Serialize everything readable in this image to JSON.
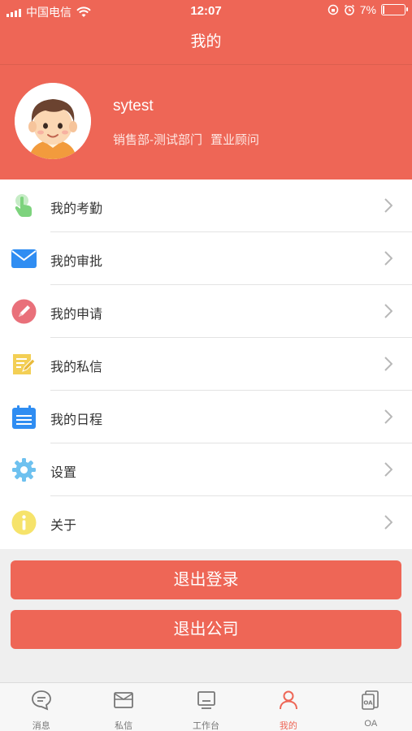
{
  "status_bar": {
    "carrier": "中国电信",
    "time": "12:07",
    "battery": "7%",
    "battery_level": 0.07
  },
  "nav": {
    "title": "我的"
  },
  "profile": {
    "username": "sytest",
    "department": "销售部-测试部门",
    "role": "置业顾问"
  },
  "menu": [
    {
      "label": "我的考勤",
      "icon": "attendance-hand-icon",
      "color": "#7dd37d"
    },
    {
      "label": "我的审批",
      "icon": "envelope-icon",
      "color": "#2f8df2"
    },
    {
      "label": "我的申请",
      "icon": "pen-circle-icon",
      "color": "#e9707a"
    },
    {
      "label": "我的私信",
      "icon": "note-edit-icon",
      "color": "#f3cf55"
    },
    {
      "label": "我的日程",
      "icon": "calendar-icon",
      "color": "#2f8df2"
    },
    {
      "label": "设置",
      "icon": "gear-icon",
      "color": "#6ec1ef"
    },
    {
      "label": "关于",
      "icon": "info-icon",
      "color": "#f6e36b"
    }
  ],
  "buttons": {
    "logout": "退出登录",
    "leave_company": "退出公司"
  },
  "tabbar": [
    {
      "label": "消息",
      "icon": "chat-bubble-icon",
      "active": false
    },
    {
      "label": "私信",
      "icon": "envelope-icon",
      "active": false
    },
    {
      "label": "工作台",
      "icon": "monitor-icon",
      "active": false
    },
    {
      "label": "我的",
      "icon": "person-icon",
      "active": true
    },
    {
      "label": "OA",
      "icon": "oa-doc-icon",
      "active": false
    }
  ],
  "colors": {
    "brand": "#ee6656",
    "tab_inactive": "#777777"
  }
}
